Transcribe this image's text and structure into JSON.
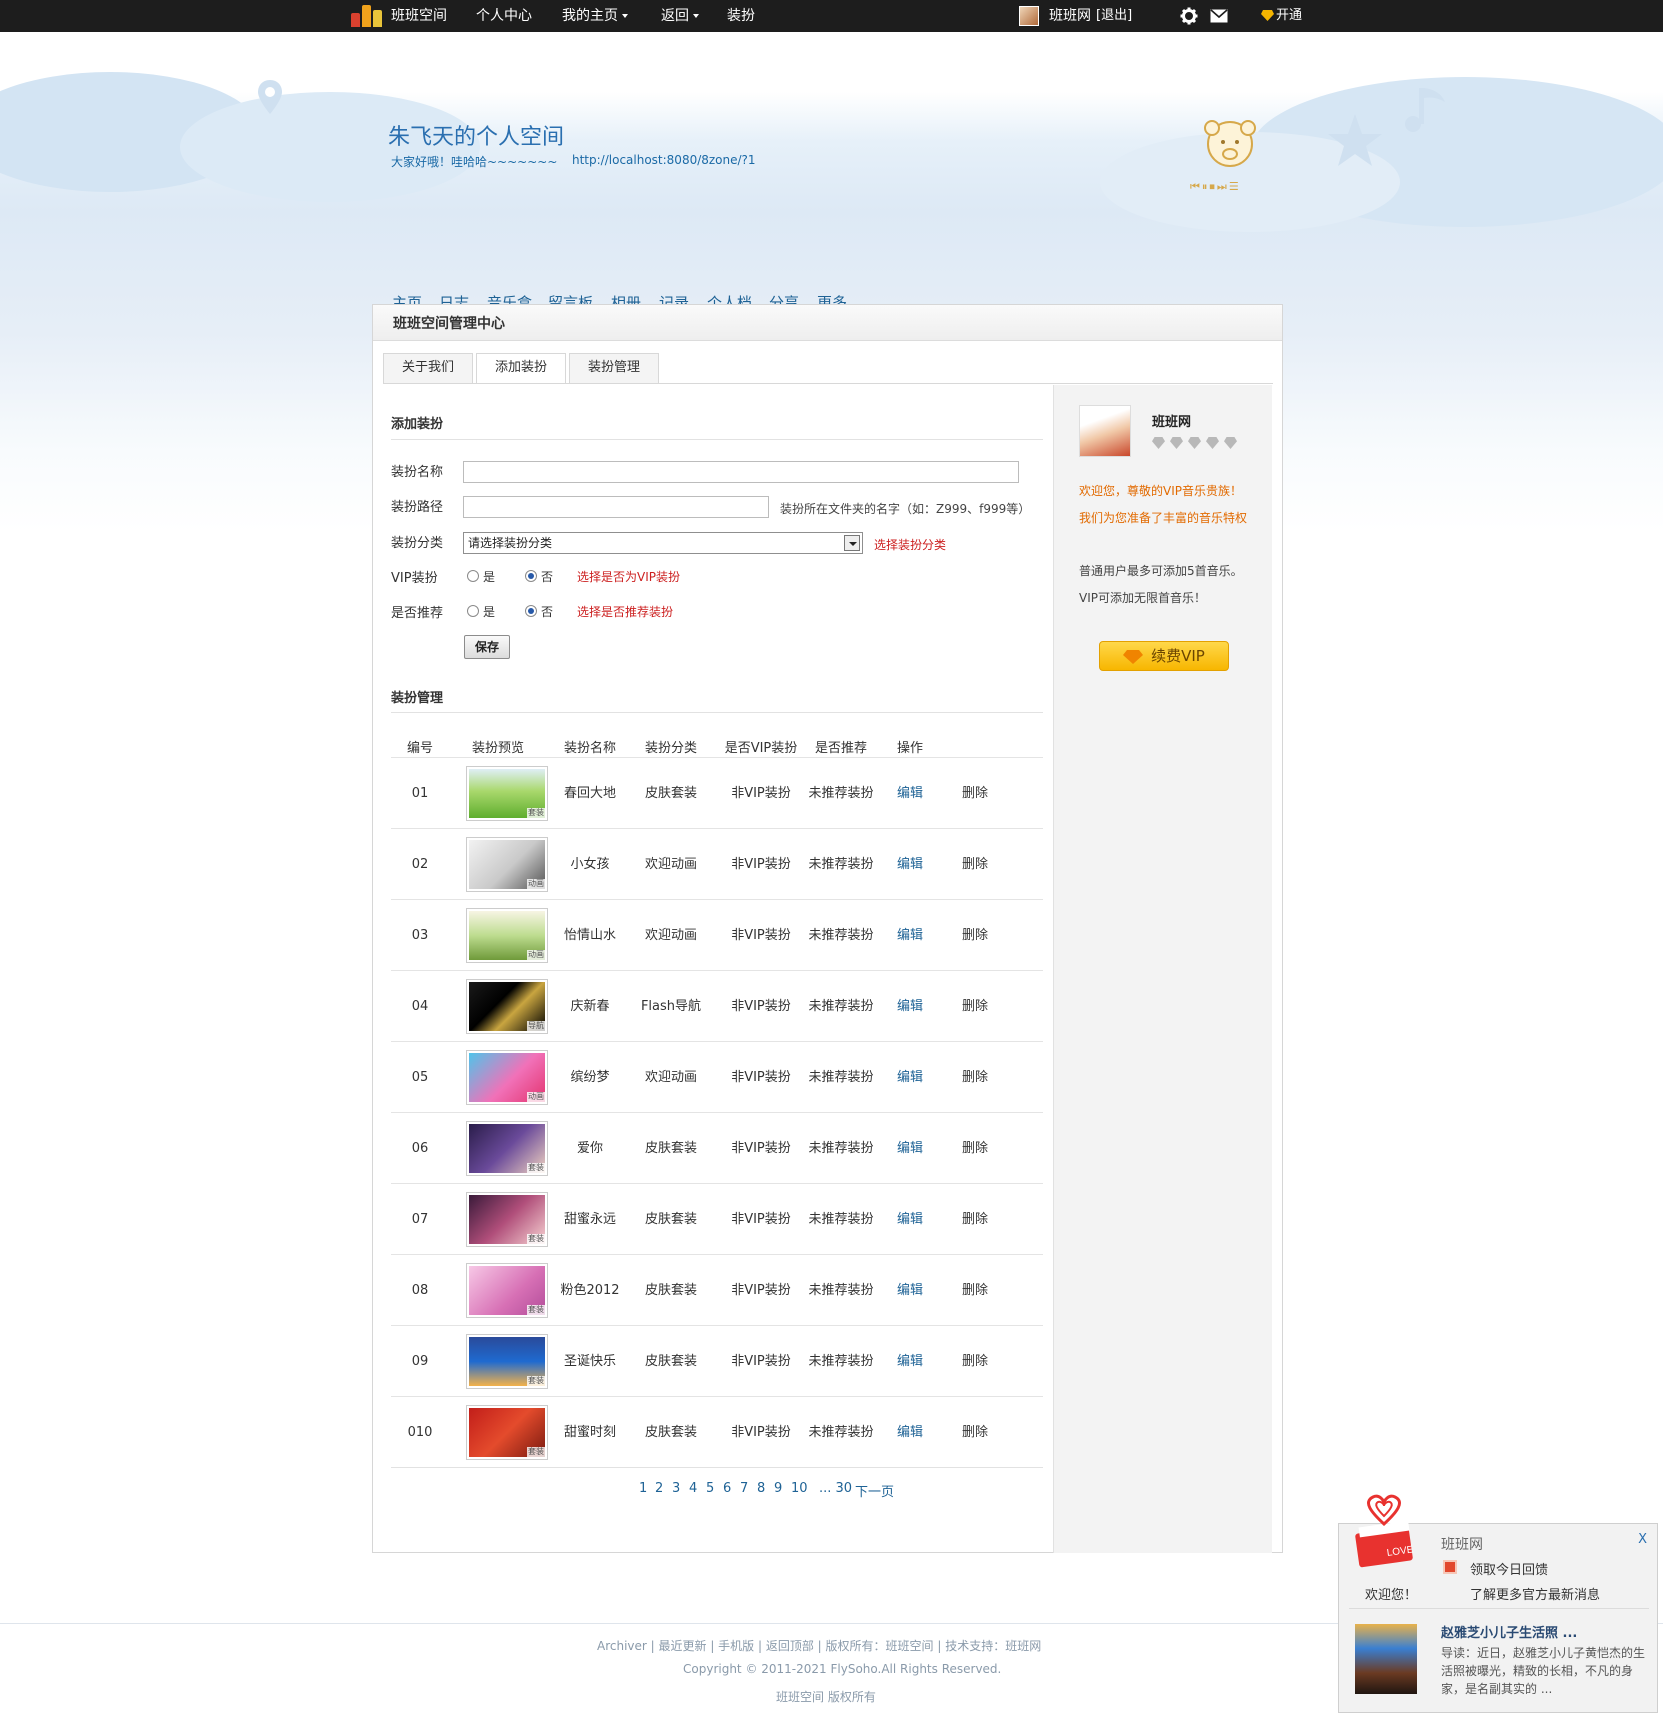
{
  "topbar": {
    "logo_text": "班班空间",
    "nav": [
      "个人中心",
      "我的主页",
      "返回",
      "装扮"
    ],
    "username": "班班网",
    "logout": "[退出]",
    "vip_link": "开通"
  },
  "banner": {
    "title": "朱飞天的个人空间",
    "subtitle": "大家好哦！哇哈哈~~~~~~~",
    "url": "http://localhost:8080/8zone/?1",
    "nav": [
      "主页",
      "日志",
      "音乐盒",
      "留言板",
      "相册",
      "记录",
      "个人档",
      "分享",
      "更多"
    ]
  },
  "panel": {
    "title": "班班空间管理中心",
    "tabs": [
      "关于我们",
      "添加装扮",
      "装扮管理"
    ]
  },
  "form": {
    "section_title": "添加装扮",
    "name_label": "装扮名称",
    "name_value": "",
    "path_label": "装扮路径",
    "path_value": "",
    "path_hint": "装扮所在文件夹的名字（如：Z999、f999等）",
    "category_label": "装扮分类",
    "category_selected": "请选择装扮分类",
    "category_hint": "选择装扮分类",
    "vip_label": "VIP装扮",
    "vip_hint": "选择是否为VIP装扮",
    "recommend_label": "是否推荐",
    "recommend_hint": "选择是否推荐装扮",
    "yes": "是",
    "no": "否",
    "vip_value": "否",
    "recommend_value": "否",
    "save_button": "保存"
  },
  "table": {
    "section_title": "装扮管理",
    "headers": [
      "编号",
      "装扮预览",
      "装扮名称",
      "装扮分类",
      "是否VIP装扮",
      "是否推荐",
      "操作"
    ],
    "rows": [
      {
        "id": "01",
        "name": "春回大地",
        "category": "皮肤套装",
        "vip": "非VIP装扮",
        "recommend": "未推荐装扮",
        "edit": "编辑",
        "delete": "删除",
        "tag": "套装"
      },
      {
        "id": "02",
        "name": "小女孩",
        "category": "欢迎动画",
        "vip": "非VIP装扮",
        "recommend": "未推荐装扮",
        "edit": "编辑",
        "delete": "删除",
        "tag": "动画"
      },
      {
        "id": "03",
        "name": "怡情山水",
        "category": "欢迎动画",
        "vip": "非VIP装扮",
        "recommend": "未推荐装扮",
        "edit": "编辑",
        "delete": "删除",
        "tag": "动画"
      },
      {
        "id": "04",
        "name": "庆新春",
        "category": "Flash导航",
        "vip": "非VIP装扮",
        "recommend": "未推荐装扮",
        "edit": "编辑",
        "delete": "删除",
        "tag": "导航"
      },
      {
        "id": "05",
        "name": "缤纷梦",
        "category": "欢迎动画",
        "vip": "非VIP装扮",
        "recommend": "未推荐装扮",
        "edit": "编辑",
        "delete": "删除",
        "tag": "动画"
      },
      {
        "id": "06",
        "name": "爱你",
        "category": "皮肤套装",
        "vip": "非VIP装扮",
        "recommend": "未推荐装扮",
        "edit": "编辑",
        "delete": "删除",
        "tag": "套装"
      },
      {
        "id": "07",
        "name": "甜蜜永远",
        "category": "皮肤套装",
        "vip": "非VIP装扮",
        "recommend": "未推荐装扮",
        "edit": "编辑",
        "delete": "删除",
        "tag": "套装"
      },
      {
        "id": "08",
        "name": "粉色2012",
        "category": "皮肤套装",
        "vip": "非VIP装扮",
        "recommend": "未推荐装扮",
        "edit": "编辑",
        "delete": "删除",
        "tag": "套装"
      },
      {
        "id": "09",
        "name": "圣诞快乐",
        "category": "皮肤套装",
        "vip": "非VIP装扮",
        "recommend": "未推荐装扮",
        "edit": "编辑",
        "delete": "删除",
        "tag": "套装"
      },
      {
        "id": "010",
        "name": "甜蜜时刻",
        "category": "皮肤套装",
        "vip": "非VIP装扮",
        "recommend": "未推荐装扮",
        "edit": "编辑",
        "delete": "删除",
        "tag": "套装"
      }
    ],
    "pager": [
      "1",
      "2",
      "3",
      "4",
      "5",
      "6",
      "7",
      "8",
      "9",
      "10",
      "... 30",
      "下一页"
    ]
  },
  "sidebar": {
    "name": "班班网",
    "vip_welcome_1": "欢迎您，尊敬的VIP音乐贵族！",
    "vip_welcome_2": "我们为您准备了丰富的音乐特权",
    "note_1": "普通用户最多可添加5首音乐。",
    "note_2": "VIP可添加无限首音乐！",
    "renew_button": "续费VIP"
  },
  "footer": {
    "links": "Archiver | 最近更新 | 手机版 | 返回顶部 | 版权所有：班班空间 | 技术支持：班班网",
    "copyright": "Copyright © 2011-2021 FlySoho.All Rights Reserved.",
    "rights": "班班空间 版权所有"
  },
  "popup": {
    "title": "班班网",
    "close": "X",
    "welcome": "欢迎您！",
    "gift": "领取今日回馈",
    "news_link": "了解更多官方最新消息",
    "news_title": "赵雅芝小儿子生活照 ...",
    "news_body": "导读：近日，赵雅芝小儿子黄恺杰的生活照被曝光，精致的长相，不凡的身家，是名副其实的 ..."
  },
  "colors": {
    "topbar": "#1d1d1d",
    "link_blue": "#1e6295",
    "hint_red": "#cc1f1f",
    "vip_orange": "#e26a00",
    "vip_button": "#f7b600"
  }
}
